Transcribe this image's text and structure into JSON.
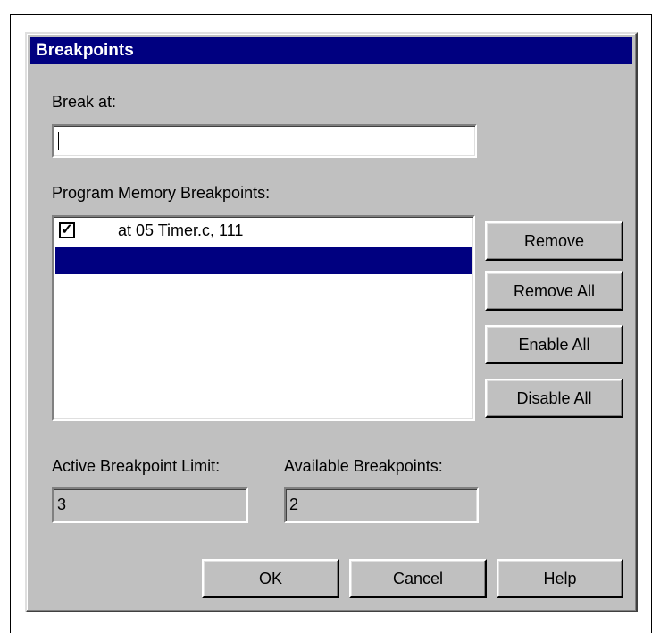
{
  "page_header_fragment": "‾‾‾‾‾‾‾‾‾‾‾‾‾‾‾‾‾‾‾‾‾‾‾‾‾‾‾‾‾‾‾‾‾‾‾‾‾‾‾‾‾‾‾‾‾‾‾‾‾‾‾‾‾‾‾‾‾‾‾‾‾",
  "dialog": {
    "title": "Breakpoints",
    "break_at_label": "Break at:",
    "break_at_value": "",
    "list_label": "Program Memory Breakpoints:",
    "breakpoints": [
      {
        "checked": true,
        "text": "at 05 Timer.c, 111"
      }
    ],
    "buttons": {
      "remove": "Remove",
      "remove_all": "Remove All",
      "enable_all": "Enable All",
      "disable_all": "Disable All",
      "ok": "OK",
      "cancel": "Cancel",
      "help": "Help"
    },
    "active_limit_label": "Active Breakpoint Limit:",
    "active_limit_value": "3",
    "available_label": "Available Breakpoints:",
    "available_value": "2"
  },
  "colors": {
    "titlebar": "#000080",
    "face": "#c0c0c0",
    "selection": "#000080"
  }
}
